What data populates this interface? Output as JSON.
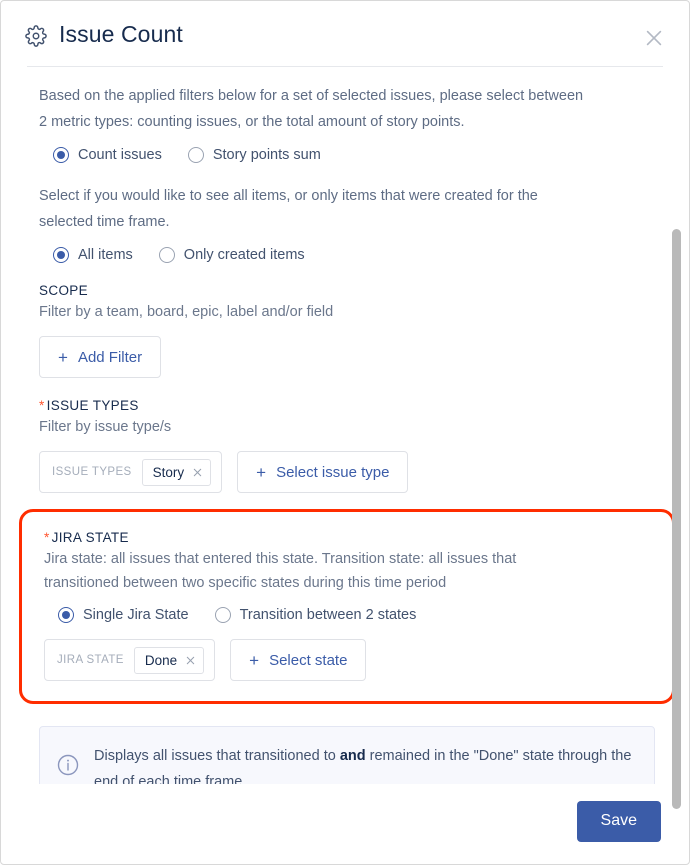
{
  "dialog": {
    "title": "Issue Count",
    "gear_icon": "gear-icon",
    "close_icon": "close-icon"
  },
  "intro": {
    "text": "Based on the applied filters below for a set of selected issues, please select between 2 metric types: counting issues, or the total amount of story points."
  },
  "metric_type": {
    "options": [
      {
        "label": "Count issues",
        "selected": true
      },
      {
        "label": "Story points sum",
        "selected": false
      }
    ]
  },
  "items_scope": {
    "text": "Select if you would like to see all items, or only items that were created for the selected time frame.",
    "options": [
      {
        "label": "All items",
        "selected": true
      },
      {
        "label": "Only created items",
        "selected": false
      }
    ]
  },
  "scope": {
    "title": "SCOPE",
    "subtitle": "Filter by a team, board, epic, label and/or field",
    "add_filter_label": "Add Filter",
    "plus": "+"
  },
  "issue_types": {
    "required": true,
    "star": "*",
    "title": "ISSUE TYPES",
    "subtitle": "Filter by issue type/s",
    "group_label": "ISSUE TYPES",
    "chips": [
      {
        "label": "Story",
        "remove_icon": "close-icon"
      }
    ],
    "select_label": "Select issue type",
    "plus": "+"
  },
  "jira_state": {
    "required": true,
    "star": "*",
    "title": "JIRA STATE",
    "subtitle": "Jira state: all issues that entered this state. Transition state: all issues that transitioned between two specific states during this time period",
    "options": [
      {
        "label": "Single Jira State",
        "selected": true
      },
      {
        "label": "Transition between 2 states",
        "selected": false
      }
    ],
    "group_label": "JIRA STATE",
    "chips": [
      {
        "label": "Done",
        "remove_icon": "close-icon"
      }
    ],
    "select_label": "Select state",
    "plus": "+",
    "highlight_color": "#ff2d00"
  },
  "info": {
    "icon": "info-icon",
    "text_before": "Displays all issues that transitioned to ",
    "emphasis": "and",
    "text_after": " remained in the \"Done\" state through the end of each time frame."
  },
  "footer": {
    "save_label": "Save"
  },
  "colors": {
    "accent": "#3b5ca8",
    "required": "#ff5630",
    "highlight": "#ff2d00",
    "info_bg": "#f7f8fd"
  }
}
